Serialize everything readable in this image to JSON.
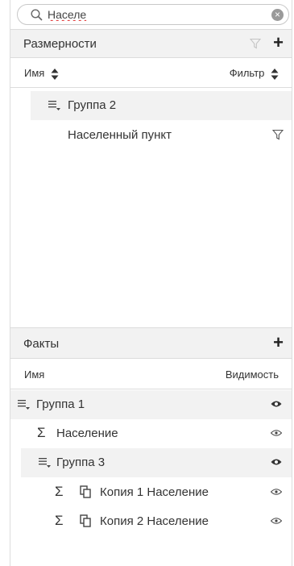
{
  "search": {
    "value": "Населе",
    "placeholder": ""
  },
  "dimensions": {
    "title": "Размерности",
    "col_name": "Имя",
    "col_filter": "Фильтр",
    "items": [
      {
        "label": "Группа 2"
      },
      {
        "label": "Населенный пункт"
      }
    ]
  },
  "facts": {
    "title": "Факты",
    "col_name": "Имя",
    "col_visibility": "Видимость",
    "items": [
      {
        "label": "Группа 1"
      },
      {
        "label": "Население"
      },
      {
        "label": "Группа 3"
      },
      {
        "label": "Копия 1 Население"
      },
      {
        "label": "Копия 2 Население"
      }
    ]
  },
  "colors": {
    "header_bg": "#f2f2f2",
    "border": "#dcdcdc",
    "text": "#333333"
  },
  "icons": [
    "search-icon",
    "clear-icon",
    "filter-icon",
    "plus-icon",
    "sort-icon",
    "group-icon",
    "sigma-icon",
    "copy-icon",
    "eye-icon"
  ]
}
